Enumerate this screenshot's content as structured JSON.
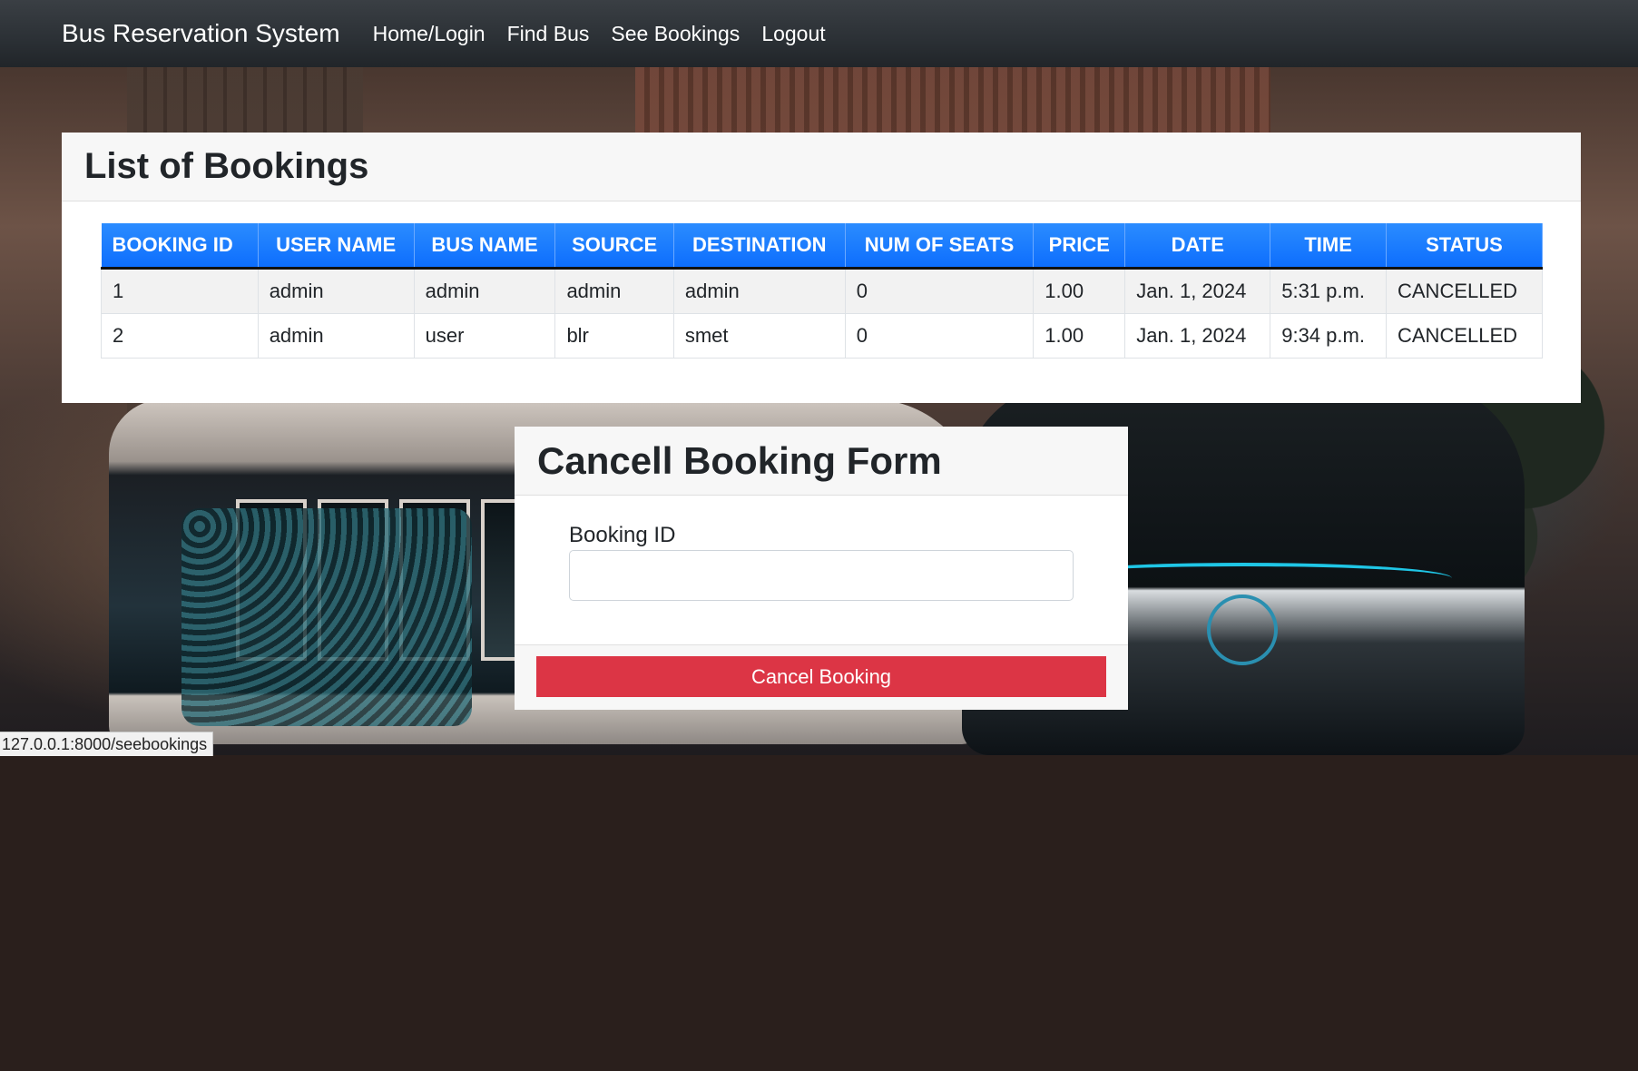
{
  "navbar": {
    "brand": "Bus Reservation System",
    "links": [
      "Home/Login",
      "Find Bus",
      "See Bookings",
      "Logout"
    ]
  },
  "bookings": {
    "title": "List of Bookings",
    "columns": [
      "BOOKING ID",
      "USER NAME",
      "BUS NAME",
      "SOURCE",
      "DESTINATION",
      "NUM OF SEATS",
      "PRICE",
      "DATE",
      "TIME",
      "STATUS"
    ],
    "rows": [
      [
        "1",
        "admin",
        "admin",
        "admin",
        "admin",
        "0",
        "1.00",
        "Jan. 1, 2024",
        "5:31 p.m.",
        "CANCELLED"
      ],
      [
        "2",
        "admin",
        "user",
        "blr",
        "smet",
        "0",
        "1.00",
        "Jan. 1, 2024",
        "9:34 p.m.",
        "CANCELLED"
      ]
    ]
  },
  "cancel_form": {
    "title": "Cancell Booking Form",
    "booking_id_label": "Booking ID",
    "booking_id_value": "",
    "submit_label": "Cancel Booking"
  },
  "statusbar": {
    "url": "127.0.0.1:8000/seebookings"
  },
  "colors": {
    "navbar": "#212529",
    "table_header": "#0d6efd",
    "danger": "#dc3545"
  }
}
